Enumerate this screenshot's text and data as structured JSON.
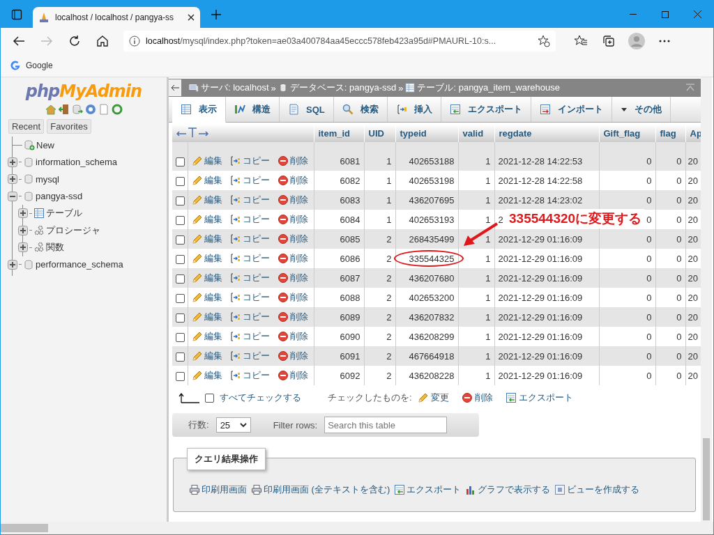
{
  "browser": {
    "tab_title": "localhost / localhost / pangya-ss",
    "url_host": "localhost",
    "url_path": "/mysql/index.php?token=ae03a400784aa45eccc578feb423a95d#PMAURL-10:s...",
    "bookmark": "Google"
  },
  "sidebar": {
    "logo_php": "php",
    "logo_myadmin": "MyAdmin",
    "tabs": [
      "Recent",
      "Favorites"
    ],
    "tree": [
      {
        "label": "New",
        "kind": "new"
      },
      {
        "label": "information_schema",
        "kind": "db",
        "expanded": false
      },
      {
        "label": "mysql",
        "kind": "db",
        "expanded": false
      },
      {
        "label": "pangya-ssd",
        "kind": "db",
        "expanded": true,
        "children": [
          {
            "label": "テーブル",
            "kind": "table",
            "expanded": false
          },
          {
            "label": "プロシージャ",
            "kind": "routine",
            "expanded": false
          },
          {
            "label": "関数",
            "kind": "routine",
            "expanded": false
          }
        ]
      },
      {
        "label": "performance_schema",
        "kind": "db",
        "expanded": false
      }
    ]
  },
  "main": {
    "breadcrumb": [
      {
        "kind": "server",
        "text": "サーバ: localhost"
      },
      {
        "kind": "separator",
        "text": "»"
      },
      {
        "kind": "database",
        "text": "データベース: pangya-ssd"
      },
      {
        "kind": "separator",
        "text": "»"
      },
      {
        "kind": "table",
        "text": "テーブル: pangya_item_warehouse"
      }
    ],
    "tabs": [
      {
        "kind": "browse",
        "label": "表示",
        "selected": true
      },
      {
        "kind": "structure",
        "label": "構造",
        "selected": false
      },
      {
        "kind": "sql",
        "label": "SQL",
        "selected": false
      },
      {
        "kind": "search",
        "label": "検索",
        "selected": false
      },
      {
        "kind": "insert",
        "label": "挿入",
        "selected": false
      },
      {
        "kind": "export",
        "label": "エクスポート",
        "selected": false
      },
      {
        "kind": "import",
        "label": "インポート",
        "selected": false
      },
      {
        "kind": "more",
        "label": "その他",
        "selected": false
      }
    ],
    "table": {
      "columns": [
        "item_id",
        "UID",
        "typeid",
        "valid",
        "regdate",
        "Gift_flag",
        "flag",
        "Ap"
      ],
      "rows": [
        {
          "checked": false,
          "circled": false,
          "actions": [
            "編集",
            "コピー",
            "削除"
          ],
          "cells": [
            "6081",
            "1",
            "402653188",
            "1",
            "2021-12-28 14:22:53",
            "0",
            "0",
            "20"
          ]
        },
        {
          "checked": false,
          "circled": false,
          "actions": [
            "編集",
            "コピー",
            "削除"
          ],
          "cells": [
            "6082",
            "1",
            "402653198",
            "1",
            "2021-12-28 14:22:58",
            "0",
            "0",
            "20"
          ]
        },
        {
          "checked": false,
          "circled": false,
          "actions": [
            "編集",
            "コピー",
            "削除"
          ],
          "cells": [
            "6083",
            "1",
            "436207695",
            "1",
            "2021-12-28 14:23:02",
            "0",
            "0",
            "20"
          ]
        },
        {
          "checked": false,
          "circled": false,
          "actions": [
            "編集",
            "コピー",
            "削除"
          ],
          "cells": [
            "6084",
            "1",
            "402653193",
            "1",
            "2",
            "0",
            "0",
            "20"
          ]
        },
        {
          "checked": false,
          "circled": false,
          "actions": [
            "編集",
            "コピー",
            "削除"
          ],
          "cells": [
            "6085",
            "2",
            "268435499",
            "1",
            "2021-12-29 01:16:09",
            "0",
            "0",
            "20"
          ]
        },
        {
          "checked": false,
          "circled": true,
          "actions": [
            "編集",
            "コピー",
            "削除"
          ],
          "cells": [
            "6086",
            "2",
            "335544325",
            "1",
            "2021-12-29 01:16:09",
            "0",
            "0",
            "20"
          ]
        },
        {
          "checked": false,
          "circled": false,
          "actions": [
            "編集",
            "コピー",
            "削除"
          ],
          "cells": [
            "6087",
            "2",
            "436207680",
            "1",
            "2021-12-29 01:16:09",
            "0",
            "0",
            "20"
          ]
        },
        {
          "checked": false,
          "circled": false,
          "actions": [
            "編集",
            "コピー",
            "削除"
          ],
          "cells": [
            "6088",
            "2",
            "402653200",
            "1",
            "2021-12-29 01:16:09",
            "0",
            "0",
            "20"
          ]
        },
        {
          "checked": false,
          "circled": false,
          "actions": [
            "編集",
            "コピー",
            "削除"
          ],
          "cells": [
            "6089",
            "2",
            "436207832",
            "1",
            "2021-12-29 01:16:09",
            "0",
            "0",
            "20"
          ]
        },
        {
          "checked": false,
          "circled": false,
          "actions": [
            "編集",
            "コピー",
            "削除"
          ],
          "cells": [
            "6090",
            "2",
            "436208299",
            "1",
            "2021-12-29 01:16:09",
            "0",
            "0",
            "20"
          ]
        },
        {
          "checked": false,
          "circled": false,
          "actions": [
            "編集",
            "コピー",
            "削除"
          ],
          "cells": [
            "6091",
            "2",
            "467664918",
            "1",
            "2021-12-29 01:16:09",
            "0",
            "0",
            "20"
          ]
        },
        {
          "checked": false,
          "circled": false,
          "actions": [
            "編集",
            "コピー",
            "削除"
          ],
          "cells": [
            "6092",
            "2",
            "436208228",
            "1",
            "2021-12-29 01:16:09",
            "0",
            "0",
            "20"
          ]
        }
      ]
    },
    "annotation": {
      "text": "335544320に変更する"
    },
    "bulk": {
      "check_all": "すべてチェックする",
      "checked": false,
      "with_selected": "チェックしたものを:",
      "actions": [
        {
          "kind": "edit",
          "label": "変更"
        },
        {
          "kind": "delete",
          "label": "削除"
        },
        {
          "kind": "export",
          "label": "エクスポート"
        }
      ]
    },
    "filter": {
      "rows_label": "行数:",
      "rows_value": "25",
      "filter_label": "Filter rows:",
      "placeholder": "Search this table"
    },
    "query_ops": {
      "title": "クエリ結果操作",
      "links": [
        {
          "kind": "print",
          "label": "印刷用画面"
        },
        {
          "kind": "print",
          "label": "印刷用画面 (全テキストを含む)"
        },
        {
          "kind": "export",
          "label": "エクスポート"
        },
        {
          "kind": "chart",
          "label": "グラフで表示する"
        },
        {
          "kind": "view",
          "label": "ビューを作成する"
        }
      ]
    }
  }
}
